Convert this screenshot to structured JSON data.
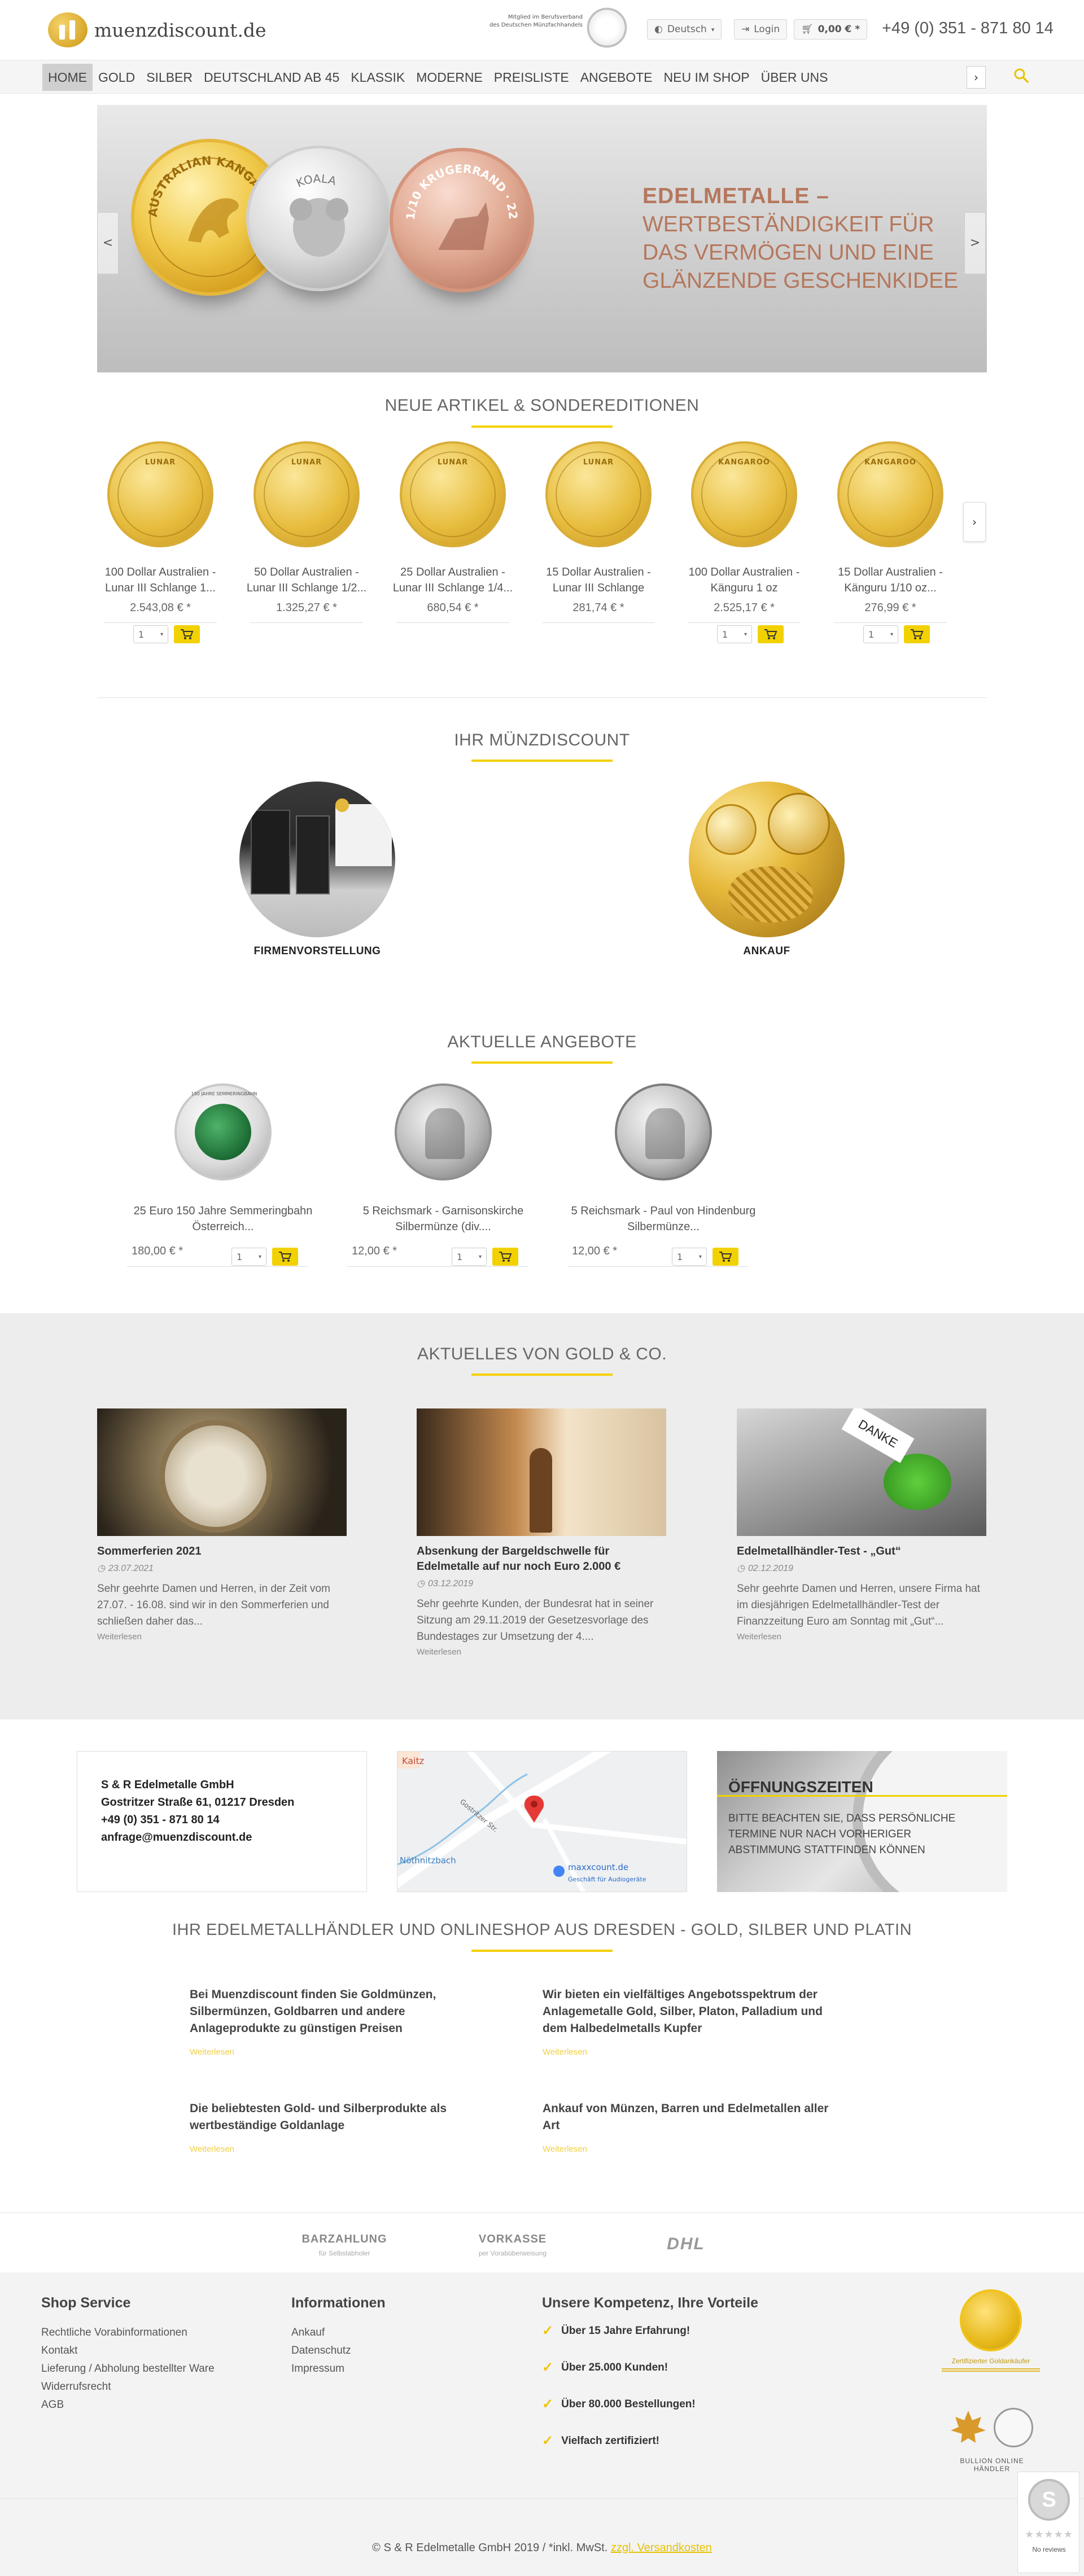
{
  "header": {
    "logo_text": "muenzdiscount.de",
    "member_line1": "Mitglied im Berufsverband",
    "member_line2": "des Deutschen Münzfachhandels",
    "language": "Deutsch",
    "login": "Login",
    "cart_total": "0,00 € *",
    "phone": "+49 (0) 351 - 871 80 14"
  },
  "nav": {
    "items": [
      "HOME",
      "GOLD",
      "SILBER",
      "DEUTSCHLAND AB 45",
      "KLASSIK",
      "MODERNE",
      "PREISLISTE",
      "ANGEBOTE",
      "NEU IM SHOP",
      "ÜBER UNS"
    ],
    "arrow": "›"
  },
  "slider": {
    "title_bold": "EDELMETALLE –",
    "title_rest": "WERTBESTÄNDIGKEIT FÜR DAS VERMÖGEN UND EINE GLÄNZENDE GESCHENKIDEE",
    "prev": "<",
    "next": ">",
    "coin1_text": "AUSTRALIAN KANGAROO 1 KILO · 2022 · GOLD",
    "coin2_text": "KOALA",
    "coin3_text": "1/10 KRUGERRAND · 22"
  },
  "new_items": {
    "heading": "NEUE ARTIKEL & SONDEREDITIONEN",
    "products": [
      {
        "name": "100 Dollar Australien - Lunar III Schlange 1...",
        "price": "2.543,08 € *",
        "qty": "1"
      },
      {
        "name": "50 Dollar Australien - Lunar III Schlange 1/2...",
        "price": "1.325,27 € *",
        "qty": ""
      },
      {
        "name": "25 Dollar Australien - Lunar III Schlange 1/4...",
        "price": "680,54 € *",
        "qty": ""
      },
      {
        "name": "15 Dollar Australien - Lunar III Schlange",
        "price": "281,74 € *",
        "qty": ""
      },
      {
        "name": "100 Dollar Australien - Känguru 1 oz",
        "price": "2.525,17 € *",
        "qty": "1"
      },
      {
        "name": "15 Dollar Australien - Känguru 1/10 oz...",
        "price": "276,99 € *",
        "qty": "1"
      }
    ],
    "coin_texts": [
      "LUNAR",
      "LUNAR",
      "LUNAR",
      "LUNAR",
      "KANGAROO",
      "KANGAROO"
    ],
    "next": "›"
  },
  "about": {
    "heading": "IHR MÜNZDISCOUNT",
    "cards": [
      {
        "label": "FIRMENVORSTELLUNG"
      },
      {
        "label": "ANKAUF"
      }
    ]
  },
  "offers": {
    "heading": "AKTUELLE ANGEBOTE",
    "items": [
      {
        "name": "25 Euro 150 Jahre Semmeringbahn Österreich...",
        "price": "180,00 € *",
        "qty": "1",
        "coin_text": "150 JAHRE SEMMERINGBAHN"
      },
      {
        "name": "5 Reichsmark - Garnisonskirche Silbermünze (div....",
        "price": "12,00 € *",
        "qty": "1",
        "coin_text": ""
      },
      {
        "name": "5 Reichsmark - Paul von Hindenburg Silbermünze...",
        "price": "12,00 € *",
        "qty": "1",
        "coin_text": ""
      }
    ]
  },
  "news": {
    "heading": "AKTUELLES VON GOLD & CO.",
    "items": [
      {
        "title": "Sommerferien 2021",
        "date": "23.07.2021",
        "text": "Sehr geehrte Damen und Herren, in der Zeit vom 27.07. - 16.08. sind wir in den Sommerferien und schließen daher das...",
        "more": "Weiterlesen"
      },
      {
        "title": "Absenkung der Bargeldschwelle für Edelmetalle auf nur noch Euro 2.000 €",
        "date": "03.12.2019",
        "text": "Sehr geehrte Kunden, der Bundesrat hat in seiner Sitzung am 29.11.2019 der Gesetzesvorlage des Bundestages zur Umsetzung der 4....",
        "more": "Weiterlesen"
      },
      {
        "title": "Edelmetallhändler-Test - „Gut“",
        "date": "02.12.2019",
        "text": "Sehr geehrte Damen und Herren, unsere Firma hat im diesjährigen Edelmetallhändler-Test der Finanzzeitung Euro am Sonntag mit „Gut“...",
        "more": "Weiterlesen"
      }
    ],
    "danke_sign": "DANKE"
  },
  "contact": {
    "company": "S & R Edelmetalle GmbH",
    "street": "Gostritzer Straße 61, 01217 Dresden",
    "phone": "+49 (0) 351 - 871 80 14",
    "email": "anfrage@muenzdiscount.de",
    "map_label1": "maxxcount.de",
    "map_label2": "Geschäft für Audiogeräte",
    "map_street": "Gostritzer Str.",
    "map_area": "Kaitz",
    "map_stream": "Nöthnitzbach",
    "opening_title": "ÖFFNUNGSZEITEN",
    "opening_text": "BITTE BEACHTEN SIE, DASS PERSÖNLICHE TERMINE NUR NACH VORHERIGER ABSTIMMUNG STATTFINDEN KÖNNEN"
  },
  "seo": {
    "heading": "IHR EDELMETALLHÄNDLER UND ONLINESHOP AUS DRESDEN - GOLD, SILBER UND PLATIN",
    "blocks": [
      {
        "text": "Bei Muenzdiscount finden Sie Goldmünzen, Silbermünzen, Goldbarren und andere Anlageprodukte zu günstigen Preisen",
        "more": "Weiterlesen"
      },
      {
        "text": "Wir bieten ein vielfältiges Angebotsspektrum der Anlagemetalle Gold, Silber, Platon, Palladium und dem Halbedelmetalls Kupfer",
        "more": "Weiterlesen"
      },
      {
        "text": "Die beliebtesten Gold- und Silberprodukte als wertbeständige Goldanlage",
        "more": "Weiterlesen"
      },
      {
        "text": "Ankauf von Münzen, Barren und Edelmetallen aller Art",
        "more": "Weiterlesen"
      }
    ]
  },
  "payment": {
    "cash": "BARZAHLUNG",
    "cash_sub": "für Selbstabholer",
    "prepay": "VORKASSE",
    "prepay_sub": "per Vorabüberweisung",
    "dhl": "DHL"
  },
  "footer": {
    "service_head": "Shop Service",
    "service_links": [
      "Rechtliche Vorabinformationen",
      "Kontakt",
      "Lieferung / Abholung bestellter Ware",
      "Widerrufsrecht",
      "AGB"
    ],
    "info_head": "Informationen",
    "info_links": [
      "Ankauf",
      "Datenschutz",
      "Impressum"
    ],
    "comp_head": "Unsere Kompetenz, Ihre Vorteile",
    "comp_items": [
      "Über 15 Jahre Erfahrung!",
      "Über 25.000 Kunden!",
      "Über 80.000 Bestellungen!",
      "Vielfach zertifiziert!"
    ],
    "cert_label1": "Zertifizierter Goldankäufer",
    "cert_label2": "BULLION ONLINE HÄNDLER",
    "copyright": "© S & R Edelmetalle GmbH 2019 / *inkl. MwSt.",
    "shipping_link": "zzgl. Versandkosten",
    "reviews_label": "No reviews"
  },
  "colors": {
    "accent": "#f2d100",
    "heading_rust": "#b5775d",
    "news_bg": "#ededed"
  }
}
